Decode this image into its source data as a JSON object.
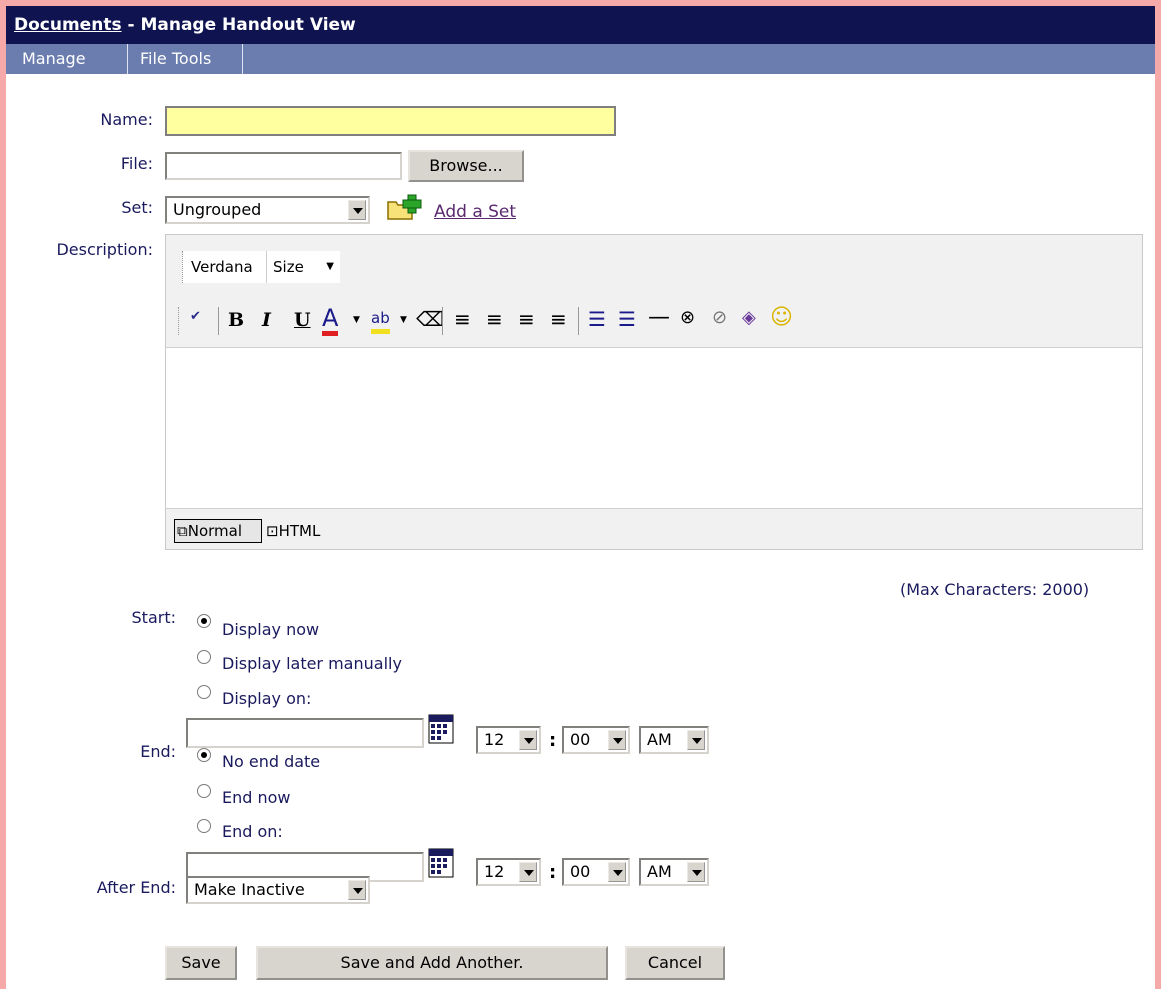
{
  "header": {
    "title_link": "Documents",
    "title_rest": " - Manage Handout View"
  },
  "menu": {
    "items": [
      "Manage",
      "File Tools"
    ]
  },
  "form": {
    "name": {
      "label": "Name:",
      "value": ""
    },
    "file": {
      "label": "File:",
      "value": "",
      "browse": "Browse..."
    },
    "set": {
      "label": "Set:",
      "selected": "Ungrouped",
      "add_link": "Add a Set"
    },
    "description": {
      "label": "Description:",
      "font": "Verdana",
      "size": "Size",
      "mode_normal": "Normal",
      "mode_html": "HTML",
      "max_chars": "(Max Characters: 2000)"
    },
    "start": {
      "label": "Start:",
      "options": [
        "Display now",
        "Display later manually",
        "Display on:"
      ],
      "hour": "12",
      "minute": "00",
      "ampm": "AM"
    },
    "end": {
      "label": "End:",
      "options": [
        "No end date",
        "End now",
        "End on:"
      ],
      "hour": "12",
      "minute": "00",
      "ampm": "AM"
    },
    "after_end": {
      "label": "After End:",
      "selected": "Make Inactive"
    }
  },
  "buttons": {
    "save": "Save",
    "save_add": "Save and Add Another.",
    "cancel": "Cancel"
  },
  "colors": {
    "titlebar": "#0f1450",
    "menubar": "#6a7dae",
    "label": "#1a1a5e",
    "name_field": "#ffff9f"
  }
}
